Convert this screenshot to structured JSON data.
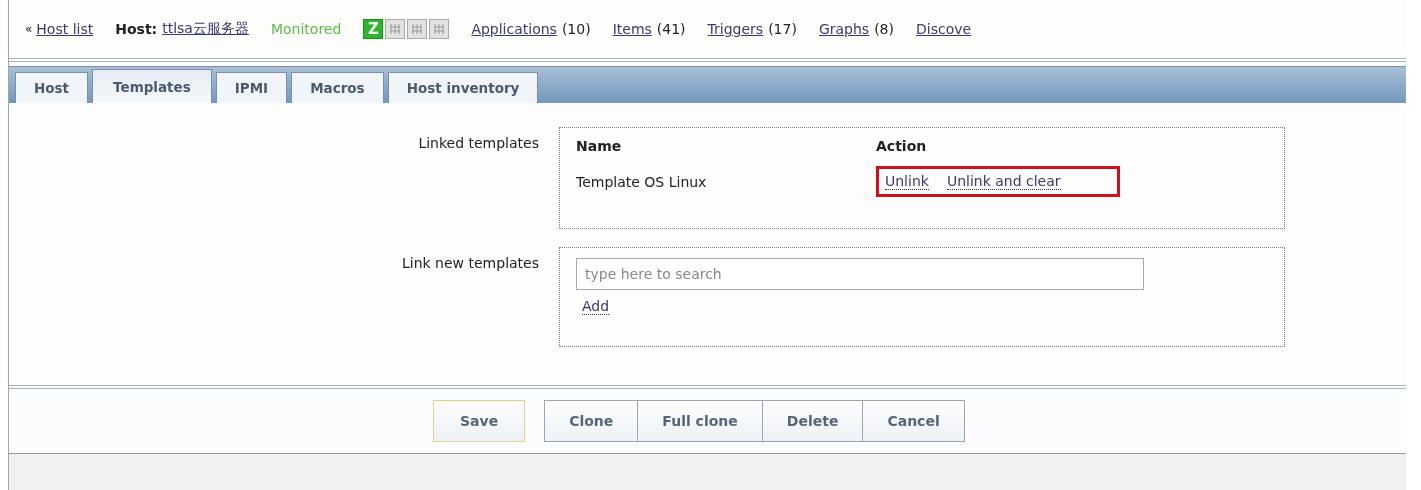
{
  "nav": {
    "back": "« ",
    "host_list": "Host list",
    "host_label": "Host:",
    "host_name": "ttlsa云服务器",
    "status": "Monitored",
    "availability": [
      {
        "kind": "zabbix",
        "label": "Z",
        "on": true
      },
      {
        "kind": "snmp",
        "on": false
      },
      {
        "kind": "jmx",
        "on": false
      },
      {
        "kind": "ipmi",
        "on": false
      }
    ],
    "links": [
      {
        "label": "Applications",
        "count": "(10)"
      },
      {
        "label": "Items",
        "count": "(41)"
      },
      {
        "label": "Triggers",
        "count": "(17)"
      },
      {
        "label": "Graphs",
        "count": "(8)"
      },
      {
        "label": "Discove"
      }
    ]
  },
  "tabs": [
    {
      "label": "Host",
      "selected": false
    },
    {
      "label": "Templates",
      "selected": true
    },
    {
      "label": "IPMI",
      "selected": false
    },
    {
      "label": "Macros",
      "selected": false
    },
    {
      "label": "Host inventory",
      "selected": false
    }
  ],
  "linked_templates": {
    "label": "Linked templates",
    "columns": [
      "Name",
      "Action"
    ],
    "rows": [
      {
        "name": "Template OS Linux",
        "actions": [
          "Unlink",
          "Unlink and clear"
        ],
        "highlighted": true
      }
    ]
  },
  "link_new_templates": {
    "label": "Link new templates",
    "placeholder": "type here to search",
    "add": "Add"
  },
  "buttons": [
    {
      "label": "Save",
      "kind": "primary"
    },
    {
      "label": "Clone",
      "kind": "group"
    },
    {
      "label": "Full clone",
      "kind": "group"
    },
    {
      "label": "Delete",
      "kind": "group"
    },
    {
      "label": "Cancel",
      "kind": "group"
    }
  ]
}
